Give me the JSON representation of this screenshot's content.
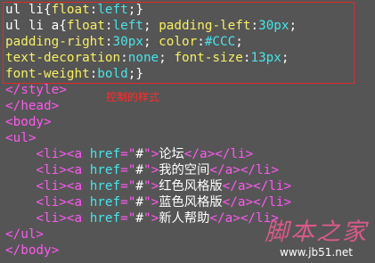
{
  "colors": {
    "background": "#555555",
    "text": "#ffffff",
    "property": "#f7f062",
    "value": "#46e5ea",
    "tag": "#ff58f2",
    "annotation": "#ff2d2d",
    "watermark": "#d85a8a"
  },
  "code": {
    "line1": [
      "ul li{",
      "float",
      ":",
      "left",
      ";}"
    ],
    "line2": [
      "ul li a{",
      "float",
      ":",
      "left",
      "; ",
      "padding-left",
      ":",
      "30px",
      ";"
    ],
    "line3": [
      "padding-right",
      ":",
      "30px",
      "; ",
      "color",
      ":",
      "#CCC",
      ";"
    ],
    "line4": [
      "text-decoration",
      ":",
      "none",
      "; ",
      "font-size",
      ":",
      "13px",
      ";"
    ],
    "line5": [
      "font-weight",
      ":",
      "bold",
      ";}"
    ],
    "line6": [
      "</style>"
    ],
    "line7": [
      "</head>"
    ],
    "line8": [
      "<body>"
    ],
    "line9": [
      "<ul>"
    ],
    "line10": [
      "    <li>",
      "<a ",
      "href",
      "=\"",
      "#",
      "\">",
      "论坛",
      "</a>",
      "</li>"
    ],
    "line11": [
      "    <li>",
      "<a ",
      "href",
      "=\"",
      "#",
      "\">",
      "我的空间",
      "</a>",
      "</li>"
    ],
    "line12": [
      "    <li>",
      "<a ",
      "href",
      "=\"",
      "#",
      "\">",
      "红色风格版",
      "</a>",
      "</li>"
    ],
    "line13": [
      "    <li>",
      "<a ",
      "href",
      "=\"",
      "#",
      "\">",
      "蓝色风格版",
      "</a>",
      "</li>"
    ],
    "line14": [
      "    <li>",
      "<a ",
      "href",
      "=\"",
      "#",
      "\">",
      "新人帮助",
      "</a>",
      "</li>"
    ],
    "line15": [
      "</ul>"
    ],
    "line16": [
      "</body>"
    ]
  },
  "annotation": "控制的样式",
  "watermark": {
    "title": "脚本之家",
    "url": "www.jb51.net"
  }
}
